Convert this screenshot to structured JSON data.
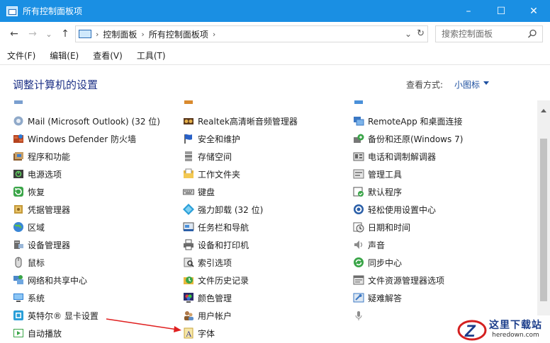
{
  "window": {
    "title": "所有控制面板项",
    "controls": {
      "minimize": "–",
      "maximize": "☐",
      "close": "✕"
    }
  },
  "navigation": {
    "back": "←",
    "forward": "→",
    "recent": "⌄",
    "up": "↑",
    "breadcrumbs": [
      "控制面板",
      "所有控制面板项"
    ],
    "breadcrumb_sep": "›",
    "dropdown": "⌄",
    "refresh": "↻",
    "search_placeholder": "搜索控制面板"
  },
  "menu": [
    "文件(F)",
    "编辑(E)",
    "查看(V)",
    "工具(T)"
  ],
  "header": {
    "title": "调整计算机的设置",
    "view_by_label": "查看方式:",
    "view_by_value": "小图标"
  },
  "items": {
    "col1": [
      {
        "label": "Windows Defender 防火墙",
        "icon": "firewall-icon"
      },
      {
        "label": "程序和功能",
        "icon": "programs-icon"
      },
      {
        "label": "电源选项",
        "icon": "power-icon"
      },
      {
        "label": "恢复",
        "icon": "recovery-icon"
      },
      {
        "label": "凭据管理器",
        "icon": "credential-icon"
      },
      {
        "label": "区域",
        "icon": "region-icon"
      },
      {
        "label": "设备管理器",
        "icon": "device-manager-icon"
      },
      {
        "label": "鼠标",
        "icon": "mouse-icon"
      },
      {
        "label": "网络和共享中心",
        "icon": "network-icon"
      },
      {
        "label": "系统",
        "icon": "system-icon"
      },
      {
        "label": "英特尔® 显卡设置",
        "icon": "intel-graphics-icon"
      },
      {
        "label": "自动播放",
        "icon": "autoplay-icon"
      }
    ],
    "col1_partial": {
      "label": "Mail (Microsoft Outlook) (32 位)",
      "icon": "mail-icon"
    },
    "col2": [
      {
        "label": "Realtek高清晰音频管理器",
        "icon": "realtek-audio-icon"
      },
      {
        "label": "安全和维护",
        "icon": "security-flag-icon"
      },
      {
        "label": "存储空间",
        "icon": "storage-icon"
      },
      {
        "label": "工作文件夹",
        "icon": "work-folders-icon"
      },
      {
        "label": "键盘",
        "icon": "keyboard-icon"
      },
      {
        "label": "强力卸载 (32 位)",
        "icon": "uninstall-icon"
      },
      {
        "label": "任务栏和导航",
        "icon": "taskbar-icon"
      },
      {
        "label": "设备和打印机",
        "icon": "printer-icon"
      },
      {
        "label": "索引选项",
        "icon": "index-icon"
      },
      {
        "label": "文件历史记录",
        "icon": "file-history-icon"
      },
      {
        "label": "颜色管理",
        "icon": "color-management-icon"
      },
      {
        "label": "用户帐户",
        "icon": "user-accounts-icon"
      },
      {
        "label": "字体",
        "icon": "fonts-icon"
      }
    ],
    "col3": [
      {
        "label": "RemoteApp 和桌面连接",
        "icon": "remoteapp-icon"
      },
      {
        "label": "备份和还原(Windows 7)",
        "icon": "backup-icon"
      },
      {
        "label": "电话和调制解调器",
        "icon": "phone-modem-icon"
      },
      {
        "label": "管理工具",
        "icon": "admin-tools-icon"
      },
      {
        "label": "默认程序",
        "icon": "default-programs-icon"
      },
      {
        "label": "轻松使用设置中心",
        "icon": "ease-of-access-icon"
      },
      {
        "label": "日期和时间",
        "icon": "date-time-icon"
      },
      {
        "label": "声音",
        "icon": "sound-icon"
      },
      {
        "label": "同步中心",
        "icon": "sync-center-icon"
      },
      {
        "label": "文件资源管理器选项",
        "icon": "explorer-options-icon"
      },
      {
        "label": "疑难解答",
        "icon": "troubleshoot-icon"
      }
    ]
  },
  "watermark": {
    "brand": "这里下载站",
    "url": "heredown.com"
  },
  "colors": {
    "titlebar": "#1a8fe3",
    "title_text": "#1e3287",
    "link": "#1e50a0",
    "annotation": "#e02020"
  }
}
